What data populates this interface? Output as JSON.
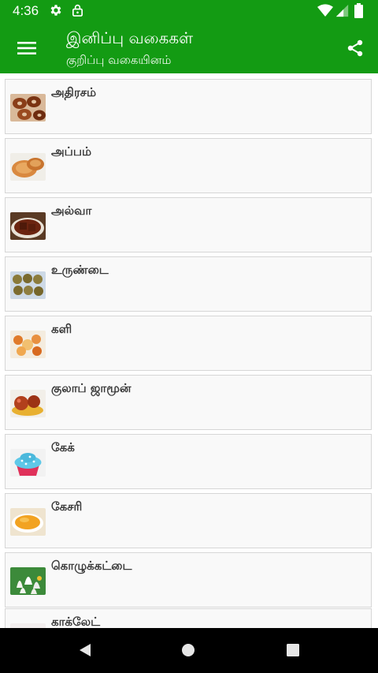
{
  "status_bar": {
    "time": "4:36",
    "icons": [
      "gear-icon",
      "lock-icon",
      "wifi-icon",
      "signal-icon",
      "battery-icon"
    ]
  },
  "app_bar": {
    "title": "இனிப்பு வகைகள்",
    "subtitle": "குறிப்பு வகையினம்",
    "menu_icon": "hamburger-menu-icon",
    "share_icon": "share-icon"
  },
  "recipes": [
    {
      "label": "அதிரசம்",
      "thumb": "adhirasam-image"
    },
    {
      "label": "அப்பம்",
      "thumb": "appam-image"
    },
    {
      "label": "அல்வா",
      "thumb": "halwa-image"
    },
    {
      "label": "உருண்டை",
      "thumb": "urundai-image"
    },
    {
      "label": "களி",
      "thumb": "kali-image"
    },
    {
      "label": "குலாப் ஜாமூன்",
      "thumb": "gulab-jamun-image"
    },
    {
      "label": "கேக்",
      "thumb": "cake-image"
    },
    {
      "label": "கேசரி",
      "thumb": "kesari-image"
    },
    {
      "label": "கொழுக்கட்டை",
      "thumb": "kozhukattai-image"
    },
    {
      "label": "காக்லேட்",
      "thumb": "chocolate-image"
    }
  ],
  "nav_bar": {
    "icons": [
      "back-icon",
      "home-icon",
      "recents-icon"
    ]
  },
  "colors": {
    "primary": "#139b13",
    "card_background": "#f9f9f9",
    "card_border": "#d6d6d6",
    "label_text": "#3a3a3a"
  }
}
